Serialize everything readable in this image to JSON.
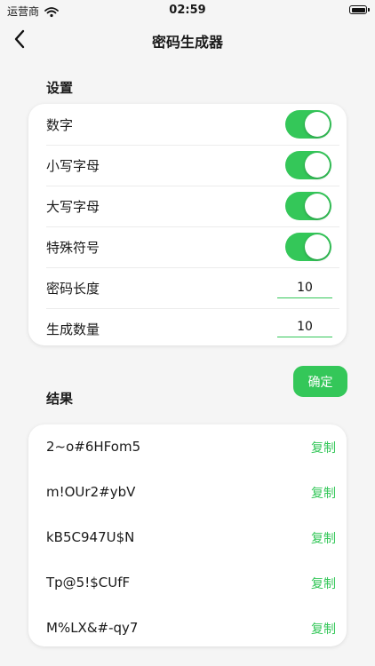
{
  "status": {
    "carrier": "运营商",
    "time": "02:59"
  },
  "nav": {
    "title": "密码生成器"
  },
  "settings": {
    "title": "设置",
    "toggles": [
      {
        "label": "数字",
        "on": true
      },
      {
        "label": "小写字母",
        "on": true
      },
      {
        "label": "大写字母",
        "on": true
      },
      {
        "label": "特殊符号",
        "on": true
      }
    ],
    "length_label": "密码长度",
    "length_value": "10",
    "count_label": "生成数量",
    "count_value": "10"
  },
  "confirm_label": "确定",
  "results": {
    "title": "结果",
    "copy_label": "复制",
    "items": [
      "2~o#6HFom5",
      "m!OUr2#ybV",
      "kB5C947U$N",
      "Tp@5!$CUfF",
      "M%LX&#-qy7"
    ]
  },
  "colors": {
    "accent": "#34c759",
    "background": "#f5f5f5",
    "card": "#ffffff"
  }
}
